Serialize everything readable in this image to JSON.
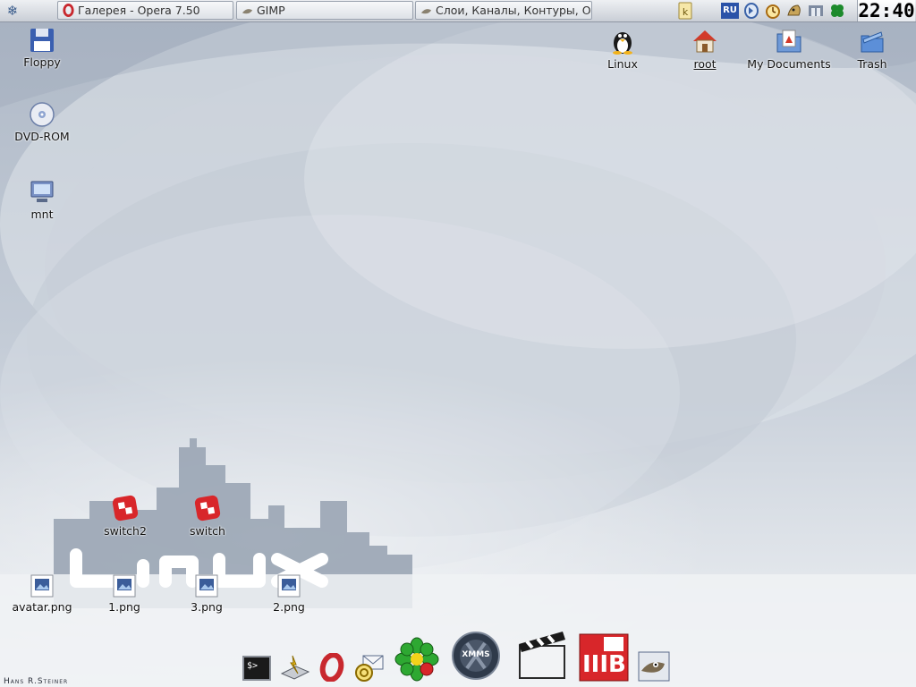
{
  "taskbar": {
    "start_label": "",
    "tasks": [
      {
        "label": "Галерея - Opera 7.50",
        "icon": "opera-icon"
      },
      {
        "label": "GIMP",
        "icon": "gimp-icon"
      },
      {
        "label": "Слои, Каналы, Контуры, Отм",
        "icon": "gimp-icon"
      }
    ],
    "tray": [
      {
        "icon": "k-notes-icon"
      },
      {
        "icon": "keyboard-layout-icon",
        "text": "RU"
      },
      {
        "icon": "mixer-icon"
      },
      {
        "icon": "alarm-clock-icon"
      },
      {
        "icon": "pet-icon"
      },
      {
        "icon": "network-icon"
      },
      {
        "icon": "klover-icon"
      }
    ],
    "clock": "22:40"
  },
  "desktop": {
    "left_icons": [
      {
        "label": "Floppy",
        "icon": "floppy-icon"
      },
      {
        "label": "DVD-ROM",
        "icon": "dvd-icon"
      },
      {
        "label": "mnt",
        "icon": "network-drive-icon"
      }
    ],
    "right_icons": [
      {
        "label": "Linux",
        "icon": "tux-icon"
      },
      {
        "label": "root",
        "icon": "home-icon"
      },
      {
        "label": "My Documents",
        "icon": "documents-folder-icon"
      },
      {
        "label": "Trash",
        "icon": "trash-icon"
      }
    ],
    "apps": [
      {
        "label": "switch2",
        "icon": "switch-app-icon"
      },
      {
        "label": "switch",
        "icon": "switch-app-icon"
      }
    ],
    "files": [
      {
        "label": "avatar.png",
        "icon": "image-file-icon"
      },
      {
        "label": "1.png",
        "icon": "image-file-icon"
      },
      {
        "label": "3.png",
        "icon": "image-file-icon"
      },
      {
        "label": "2.png",
        "icon": "image-file-icon"
      }
    ],
    "credit": "Hans R.Steiner"
  },
  "dock": {
    "items": [
      {
        "icon": "terminal-icon",
        "text": "$>"
      },
      {
        "icon": "drive-mount-icon"
      },
      {
        "icon": "opera-icon"
      },
      {
        "icon": "mail-icon"
      },
      {
        "icon": "icq-icon"
      },
      {
        "icon": "xmms-icon",
        "text": "XMMS"
      },
      {
        "icon": "clapper-icon"
      },
      {
        "icon": "kib-icon",
        "text": "IIIB"
      },
      {
        "icon": "gimp-icon"
      }
    ]
  }
}
